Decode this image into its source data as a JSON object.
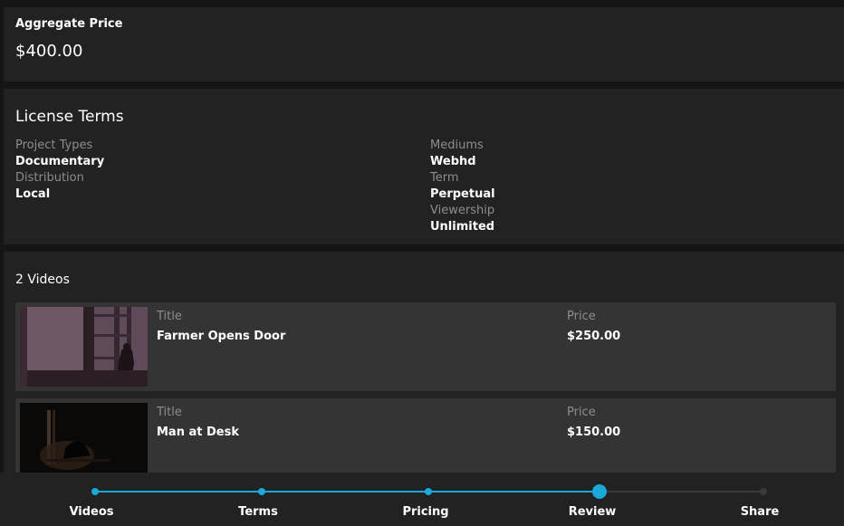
{
  "aggregate": {
    "label": "Aggregate Price",
    "value": "$400.00"
  },
  "license_terms": {
    "title": "License Terms",
    "left": [
      {
        "label": "Project Types",
        "value": "Documentary"
      },
      {
        "label": "Distribution",
        "value": "Local"
      }
    ],
    "right": [
      {
        "label": "Mediums",
        "value": "Webhd"
      },
      {
        "label": "Term",
        "value": "Perpetual"
      },
      {
        "label": "Viewership",
        "value": "Unlimited"
      }
    ]
  },
  "videos": {
    "title": "2 Videos",
    "items": [
      {
        "title_label": "Title",
        "title": "Farmer Opens Door",
        "price_label": "Price",
        "price": "$250.00"
      },
      {
        "title_label": "Title",
        "title": "Man at Desk",
        "price_label": "Price",
        "price": "$150.00"
      }
    ]
  },
  "stepper": {
    "steps": [
      "Videos",
      "Terms",
      "Pricing",
      "Review",
      "Share"
    ],
    "current": "Review",
    "accent_color": "#1aa9d8"
  }
}
